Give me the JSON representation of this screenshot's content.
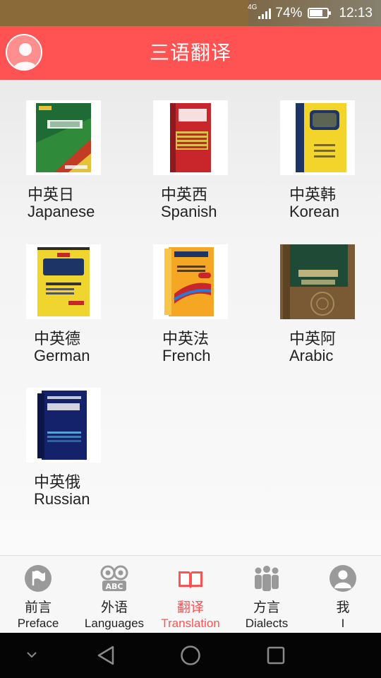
{
  "status_bar": {
    "network": "4G",
    "battery": "74%",
    "battery_level": 0.74,
    "time": "12:13"
  },
  "header": {
    "title": "三语翻译",
    "avatar_icon": "user-avatar-icon"
  },
  "books": [
    {
      "cn": "中英日",
      "en": "Japanese",
      "cover_color": "#1f6b35"
    },
    {
      "cn": "中英西",
      "en": "Spanish",
      "cover_color": "#c8262b"
    },
    {
      "cn": "中英韩",
      "en": "Korean",
      "cover_color": "#f2d42a"
    },
    {
      "cn": "中英德",
      "en": "German",
      "cover_color": "#f0d52e"
    },
    {
      "cn": "中英法",
      "en": "French",
      "cover_color": "#f5a623"
    },
    {
      "cn": "中英阿",
      "en": "Arabic",
      "cover_color": "#7a5a34"
    },
    {
      "cn": "中英俄",
      "en": "Russian",
      "cover_color": "#13226b"
    }
  ],
  "bottom_nav": [
    {
      "cn": "前言",
      "en": "Preface",
      "icon": "flag-icon",
      "active": false
    },
    {
      "cn": "外语",
      "en": "Languages",
      "icon": "abc-owl-icon",
      "active": false
    },
    {
      "cn": "翻译",
      "en": "Translation",
      "icon": "open-book-icon",
      "active": true
    },
    {
      "cn": "方言",
      "en": "Dialects",
      "icon": "people-icon",
      "active": false
    },
    {
      "cn": "我",
      "en": "I",
      "icon": "user-icon",
      "active": false
    }
  ],
  "colors": {
    "accent": "#ff5252",
    "nav_icon_gray": "#9a9a9a"
  }
}
